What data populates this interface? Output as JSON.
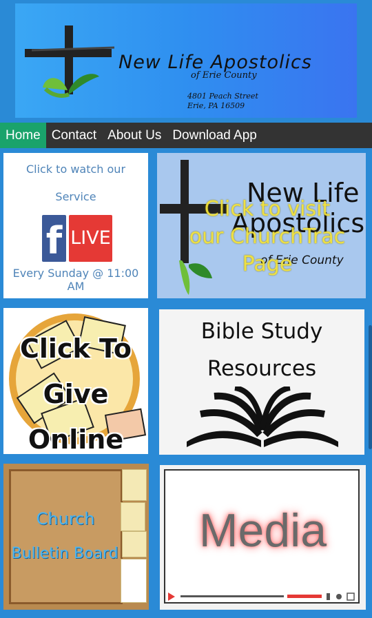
{
  "header": {
    "title": "New Life Apostolics",
    "subtitle": "of Erie County",
    "address_line1": "4801 Peach Street",
    "address_line2": "Erie, PA 16509"
  },
  "nav": {
    "items": [
      {
        "label": "Home",
        "active": true
      },
      {
        "label": "Contact",
        "active": false
      },
      {
        "label": "About Us",
        "active": false
      },
      {
        "label": "Download App",
        "active": false
      }
    ],
    "active_color": "#1aa36b",
    "bar_color": "#333333"
  },
  "tiles": {
    "watch": {
      "line1": "Click to watch our",
      "line2": "Service",
      "badge_f": "f",
      "badge_live": "LIVE",
      "schedule": "Every Sunday @ 11:00 AM"
    },
    "churchtrac": {
      "logo_line1": "New Life",
      "logo_line2": "Apostolics",
      "logo_line3": "of Erie County",
      "cta": "Click to visit our ChurchTrac Page"
    },
    "give": {
      "line1": "Click To",
      "line2": "Give",
      "line3": "Online"
    },
    "bible": {
      "line1": "Bible Study",
      "line2": "Resources"
    },
    "bulletin": {
      "line1": "Church",
      "line2": "Bulletin Board"
    },
    "media": {
      "label": "Media"
    }
  },
  "colors": {
    "page_background": "#2a8ad6",
    "banner_blue": "#2f8ff0"
  }
}
